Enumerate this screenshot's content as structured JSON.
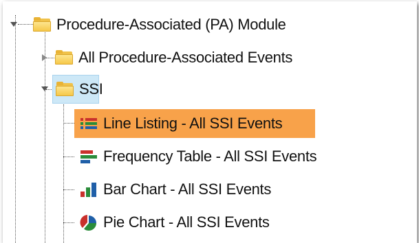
{
  "tree": {
    "module": {
      "label": "Procedure-Associated (PA) Module",
      "icon": "folder-icon"
    },
    "all_events": {
      "label": "All Procedure-Associated Events",
      "icon": "folder-icon",
      "expanded": false
    },
    "ssi": {
      "label": "SSI",
      "icon": "folder-icon",
      "expanded": true,
      "children": [
        {
          "label": "Line Listing - All SSI Events",
          "icon": "line-listing-icon",
          "selected": true
        },
        {
          "label": "Frequency Table - All SSI Events",
          "icon": "frequency-table-icon"
        },
        {
          "label": "Bar Chart - All SSI Events",
          "icon": "bar-chart-icon"
        },
        {
          "label": "Pie Chart - All SSI Events",
          "icon": "pie-chart-icon"
        }
      ]
    }
  },
  "colors": {
    "highlight": "#f8a24a",
    "ssi_selected_bg": "#cde8f7",
    "folder": "#f6c84a"
  }
}
